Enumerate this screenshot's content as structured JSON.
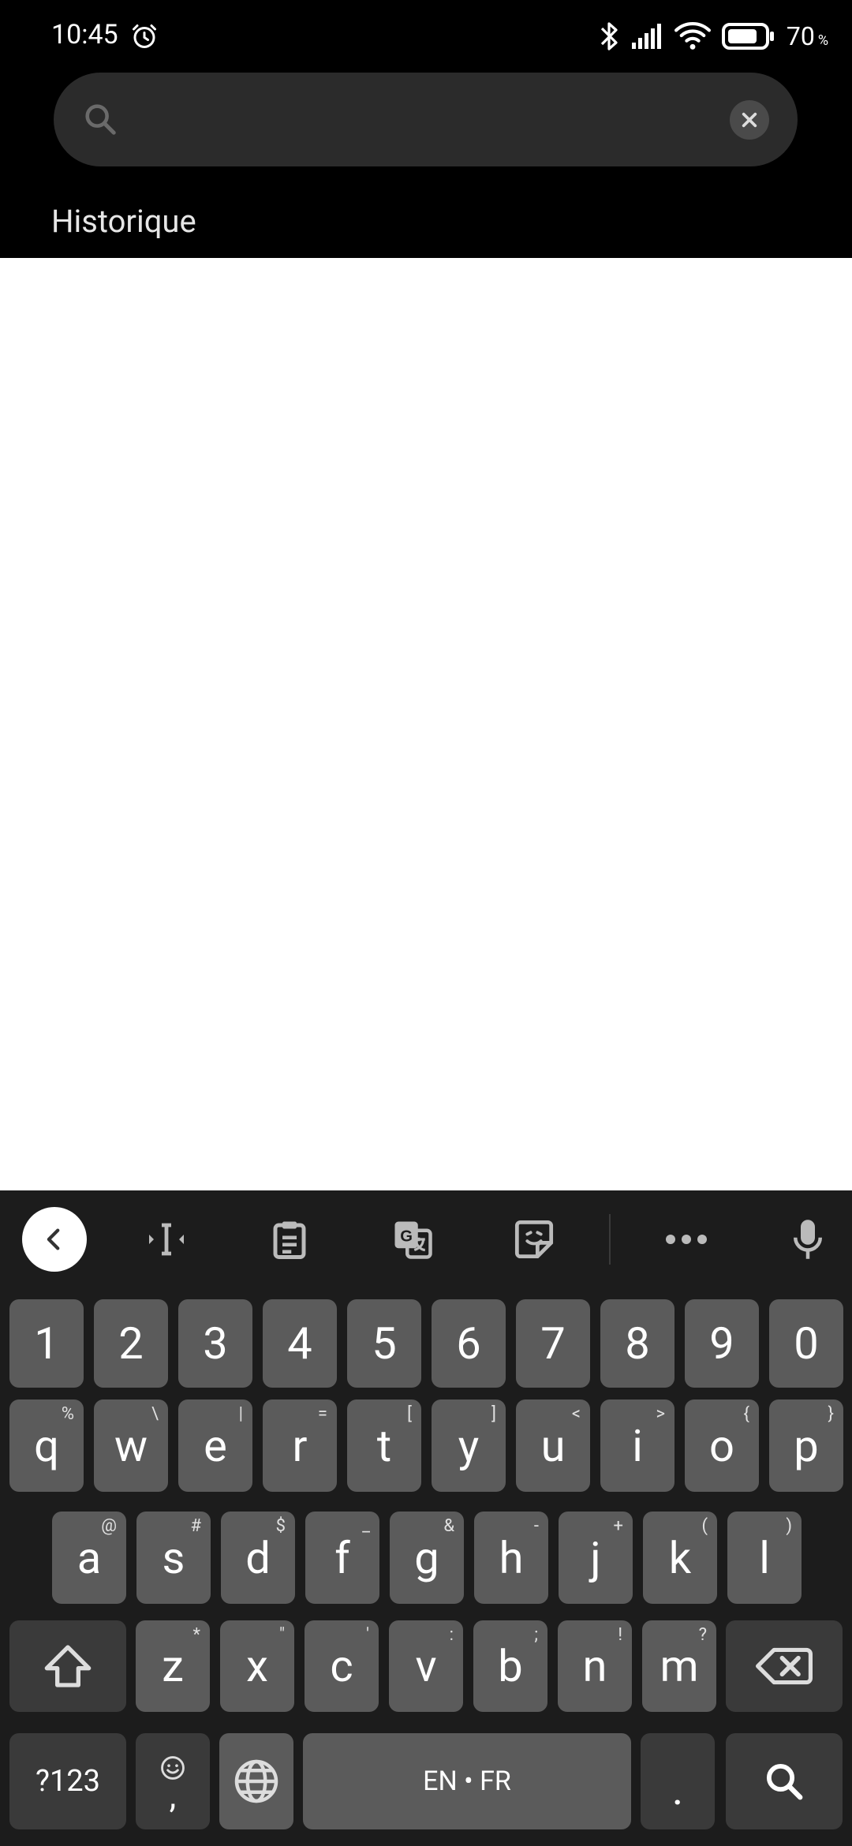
{
  "status_bar": {
    "time": "10:45",
    "battery_percent": "70",
    "battery_unit": "%"
  },
  "search": {
    "value": "",
    "placeholder": ""
  },
  "history": {
    "title": "Historique"
  },
  "keyboard": {
    "row1": [
      "1",
      "2",
      "3",
      "4",
      "5",
      "6",
      "7",
      "8",
      "9",
      "0"
    ],
    "row2": [
      {
        "k": "q",
        "alt": "%"
      },
      {
        "k": "w",
        "alt": "\\"
      },
      {
        "k": "e",
        "alt": "|"
      },
      {
        "k": "r",
        "alt": "="
      },
      {
        "k": "t",
        "alt": "["
      },
      {
        "k": "y",
        "alt": "]"
      },
      {
        "k": "u",
        "alt": "<"
      },
      {
        "k": "i",
        "alt": ">"
      },
      {
        "k": "o",
        "alt": "{"
      },
      {
        "k": "p",
        "alt": "}"
      }
    ],
    "row3": [
      {
        "k": "a",
        "alt": "@"
      },
      {
        "k": "s",
        "alt": "#"
      },
      {
        "k": "d",
        "alt": "$"
      },
      {
        "k": "f",
        "alt": "_"
      },
      {
        "k": "g",
        "alt": "&"
      },
      {
        "k": "h",
        "alt": "-"
      },
      {
        "k": "j",
        "alt": "+"
      },
      {
        "k": "k",
        "alt": "("
      },
      {
        "k": "l",
        "alt": ")"
      }
    ],
    "row4": [
      {
        "k": "z",
        "alt": "*"
      },
      {
        "k": "x",
        "alt": "\""
      },
      {
        "k": "c",
        "alt": "'"
      },
      {
        "k": "v",
        "alt": ":"
      },
      {
        "k": "b",
        "alt": ";"
      },
      {
        "k": "n",
        "alt": "!"
      },
      {
        "k": "m",
        "alt": "?"
      }
    ],
    "symbols_label": "?123",
    "comma_label": ",",
    "space_label": "EN • FR",
    "period_label": "."
  }
}
